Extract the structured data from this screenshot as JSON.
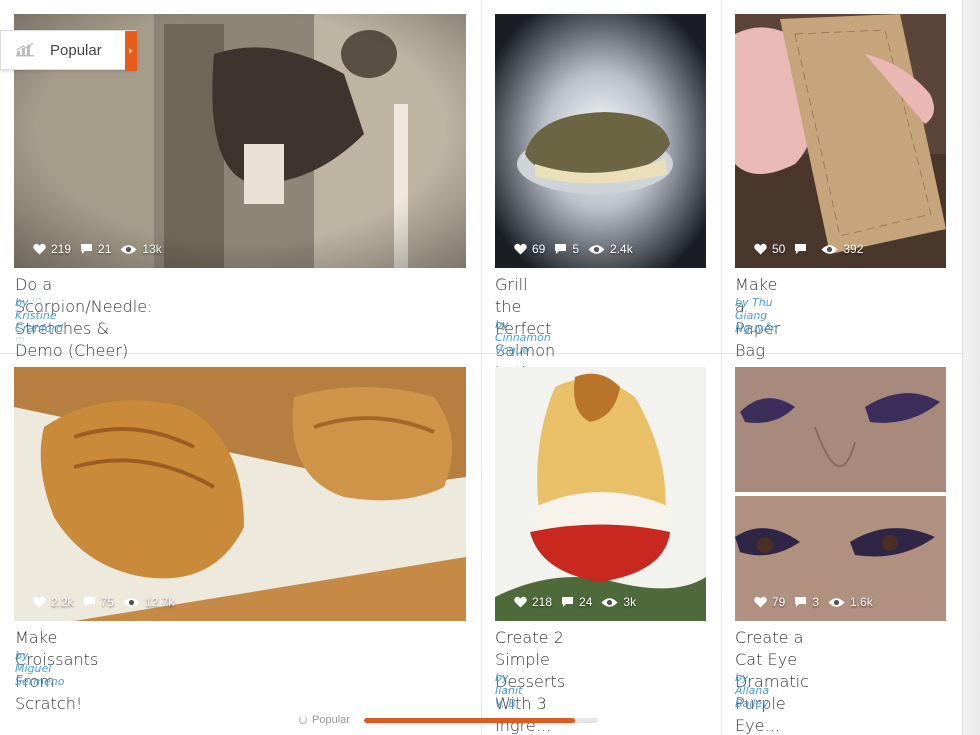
{
  "popular_tab": {
    "label": "Popular",
    "icon": "bar-chart-icon"
  },
  "cards": [
    {
      "title_lines": [
        "Do a Scorpion/Needle: Stretches & Demo (Cheer)"
      ],
      "author": "by ♡ Kristine Cranford ♡",
      "likes": "219",
      "comments": "21",
      "views": "13k"
    },
    {
      "title_lines": [
        "Grill the Perfect Salmon",
        "in the Toaster Oven"
      ],
      "author": "by Cinnamon Vogue",
      "likes": "69",
      "comments": "5",
      "views": "2.4k"
    },
    {
      "title_lines": [
        "Make a Paper Bag"
      ],
      "author": "by Thu Giang Nguyễn",
      "likes": "50",
      "comments": "",
      "views": "392"
    },
    {
      "title_lines": [
        "Make Croissants From Scratch!"
      ],
      "author": "by Miguel Sermeno",
      "likes": "2.2k",
      "comments": "75",
      "views": "12.7k"
    },
    {
      "title_lines": [
        "Create 2 Simple",
        "Desserts With 3 Ingre..."
      ],
      "author": "by Ilanit V. B.",
      "likes": "218",
      "comments": "24",
      "views": "3k"
    },
    {
      "title_lines": [
        "Create a Cat Eye",
        "Dramatic Purple Eye..."
      ],
      "author": "by Allana Bailey",
      "likes": "79",
      "comments": "3",
      "views": "1.6k"
    }
  ],
  "footer": {
    "label": "Popular",
    "progress": 0.9
  },
  "colors": {
    "accent": "#e05a1c",
    "author": "#4a9fd6",
    "title": "#333333"
  }
}
